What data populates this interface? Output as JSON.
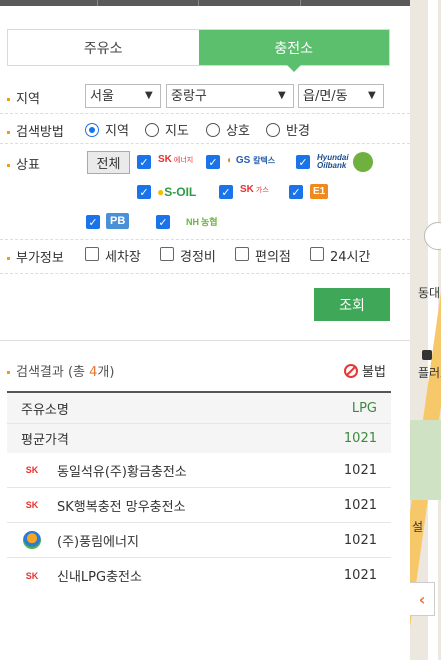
{
  "tabs": [
    {
      "label": "주유소",
      "active": false
    },
    {
      "label": "충전소",
      "active": true
    }
  ],
  "region": {
    "label": "지역",
    "sido": "서울",
    "gu": "중랑구",
    "dong_placeholder": "읍/면/동"
  },
  "search_method": {
    "label": "검색방법",
    "options": [
      "지역",
      "지도",
      "상호",
      "반경"
    ],
    "selected": "지역"
  },
  "brand": {
    "label": "상표",
    "all_button": "전체",
    "items": [
      {
        "name": "SK에너지",
        "logo_text": "SK",
        "sub": "에너지",
        "checked": true
      },
      {
        "name": "GS칼텍스",
        "logo_text": "GS",
        "sub": "칼텍스",
        "checked": true
      },
      {
        "name": "현대오일뱅크",
        "logo_text": "Hyundai",
        "sub": "Oilbank",
        "checked": true
      },
      {
        "name": "S-OIL",
        "logo_text": "S-OIL",
        "checked": true
      },
      {
        "name": "SK가스",
        "logo_text": "SK",
        "sub": "가스",
        "checked": true
      },
      {
        "name": "E1",
        "logo_text": "E1",
        "checked": true
      },
      {
        "name": "PB",
        "logo_text": "PB",
        "checked": true
      },
      {
        "name": "NH농협",
        "logo_text": "NH",
        "sub": "농협",
        "checked": true
      }
    ]
  },
  "extra": {
    "label": "부가정보",
    "options": [
      "세차장",
      "경정비",
      "편의점",
      "24시간"
    ]
  },
  "search_button": "조회",
  "results": {
    "prefix": "검색결과 (총 ",
    "count": "4",
    "suffix": "개)",
    "illegal_label": "불법",
    "columns": {
      "name": "주유소명",
      "price": "LPG"
    },
    "average": {
      "label": "평균가격",
      "value": "1021"
    },
    "rows": [
      {
        "brand": "SK",
        "brand_sub": "에너지",
        "name": "동일석유(주)황금충전소",
        "price": "1021"
      },
      {
        "brand": "SK",
        "brand_sub": "가스",
        "name": "SK행복충전 망우충전소",
        "price": "1021"
      },
      {
        "brand": "E1",
        "brand_sub": "",
        "name": "(주)풍림에너지",
        "price": "1021"
      },
      {
        "brand": "SK",
        "brand_sub": "에너지",
        "name": "신내LPG충전소",
        "price": "1021"
      }
    ]
  },
  "map": {
    "labels": [
      "동대",
      "플러스",
      "설"
    ]
  },
  "colors": {
    "accent": "#5cbf6d",
    "button": "#3fa858",
    "checkbox": "#1a73e8",
    "count": "#e8752e"
  }
}
